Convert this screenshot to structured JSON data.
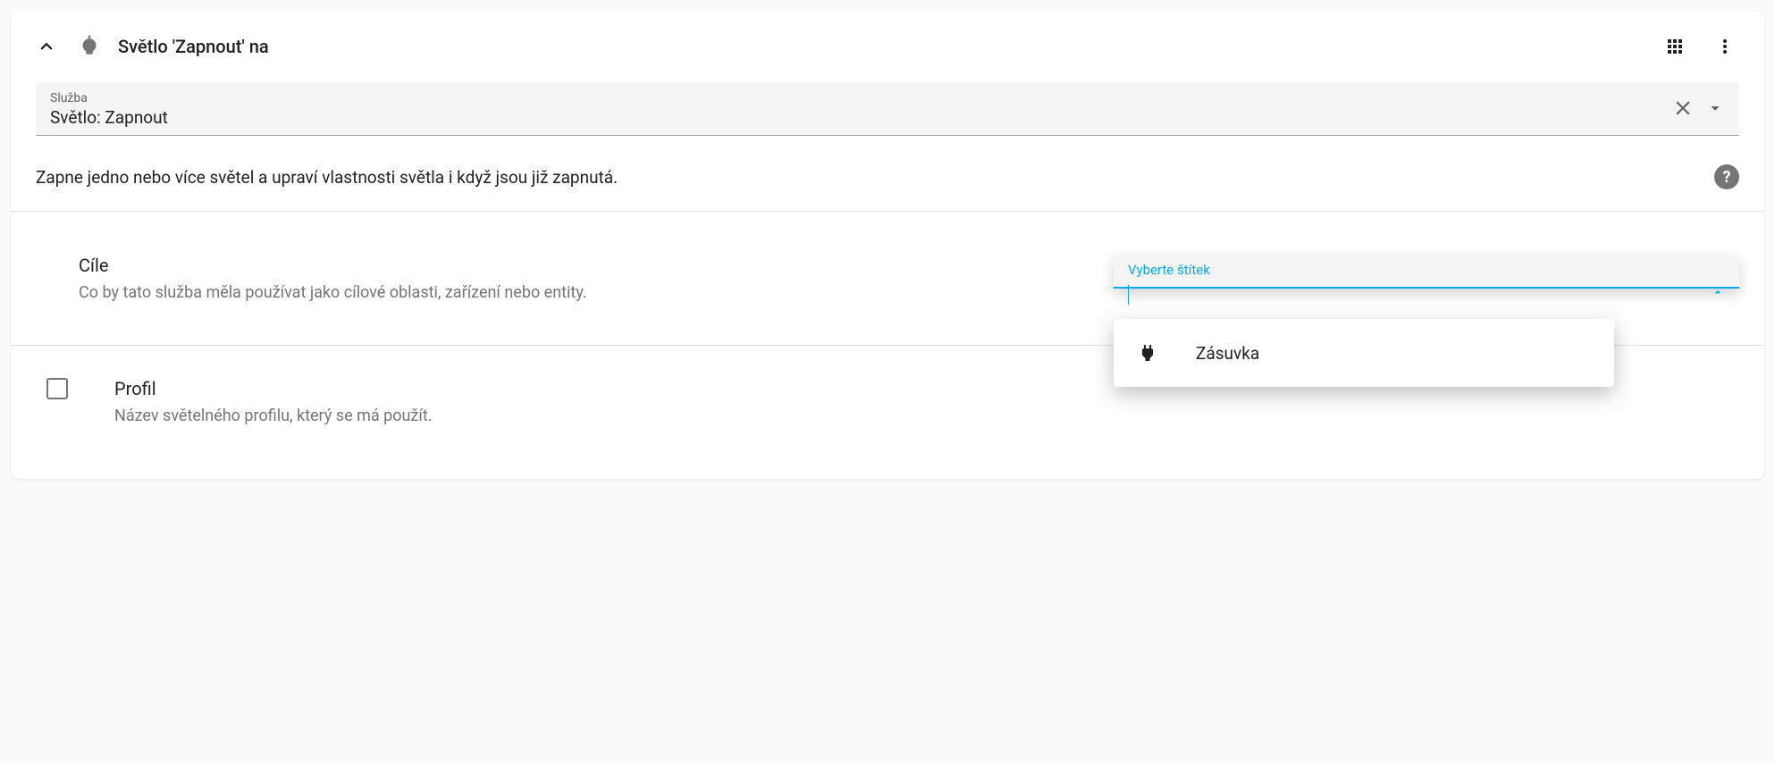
{
  "header": {
    "title": "Světlo 'Zapnout' na"
  },
  "service": {
    "label": "Služba",
    "value": "Světlo: Zapnout",
    "description": "Zapne jedno nebo více světel a upraví vlastnosti světla i když jsou již zapnutá."
  },
  "targets": {
    "title": "Cíle",
    "subtitle": "Co by tato služba měla používat jako cílové oblasti, zařízení nebo entity.",
    "input_label": "Vyberte štítek",
    "options": [
      {
        "icon": "power-plug",
        "label": "Zásuvka"
      }
    ]
  },
  "profile": {
    "title": "Profil",
    "subtitle": "Název světelného profilu, který se má použít."
  },
  "colors": {
    "accent": "#03a9f4"
  }
}
